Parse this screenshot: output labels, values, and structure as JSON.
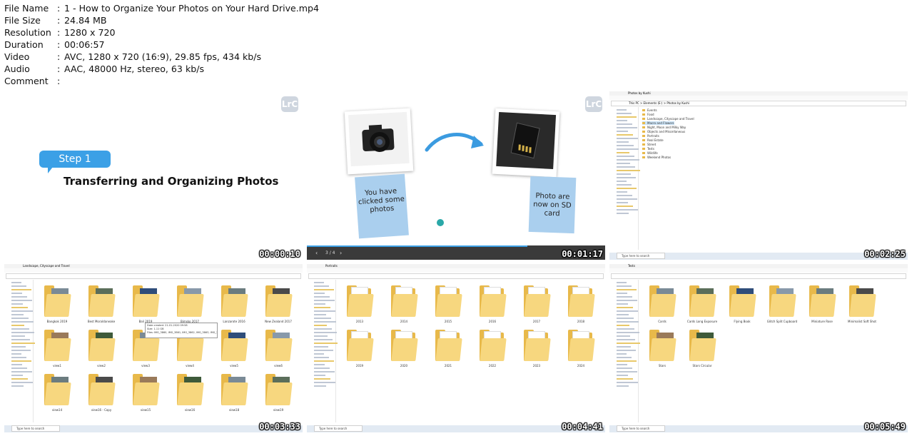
{
  "meta": {
    "rows": [
      {
        "k": "File Name",
        "v": "1 - How to Organize Your Photos on Your Hard Drive.mp4"
      },
      {
        "k": "File Size",
        "v": "24.84 MB"
      },
      {
        "k": "Resolution",
        "v": "1280 x 720"
      },
      {
        "k": "Duration",
        "v": "00:06:57"
      },
      {
        "k": "Video",
        "v": "AVC, 1280 x 720 (16:9), 29.85 fps, 434 kb/s"
      },
      {
        "k": "Audio",
        "v": "AAC, 48000 Hz, stereo, 63 kb/s"
      },
      {
        "k": "Comment",
        "v": ""
      }
    ],
    "sep": ":"
  },
  "thumbs": [
    {
      "timestamp": "00:00:10",
      "step_label": "Step 1",
      "heading": "Transferring and Organizing Photos",
      "badge": "LrC"
    },
    {
      "timestamp": "00:01:17",
      "note1": "You have clicked some photos",
      "note2": "Photo are now on SD card",
      "badge": "LrC",
      "pager": "3 / 4"
    },
    {
      "timestamp": "00:02:25",
      "window_title": "Photos by Kushi",
      "path": "This PC > Elements (E:) > Photos by Kushi",
      "folders": [
        "Events",
        "Food",
        "Landscape, Cityscape and Travel",
        "Macro and Flowers",
        "Night, Moon and Milky Way",
        "Objects and Miscellaneous",
        "Portraits",
        "Real Estate",
        "Street",
        "Tests",
        "Wildlife",
        "Weekend Photos"
      ],
      "search": "Type here to search"
    },
    {
      "timestamp": "00:03:33",
      "window_title": "Landscape, Cityscape and Travel",
      "labels": [
        "Bangkok 2019",
        "Best Moraldaneake",
        "Bali 2019",
        "Bimsko 2017",
        "Lanzarote 2016",
        "New Zealand 2017",
        "view1",
        "view2",
        "view3",
        "view4",
        "view5",
        "view6",
        "view14",
        "view16 - Copy",
        "view15",
        "view16",
        "view18",
        "view19"
      ],
      "tooltip": "Date created: 21-01-2020 09:58\nSize: 1.11 GB\nFiles: IMG_3860, IMG_3861, IMG_3862, IMG_3863, IMG_3864",
      "search": "Type here to search"
    },
    {
      "timestamp": "00:04:41",
      "window_title": "Portraits",
      "labels": [
        "2013",
        "2014",
        "2015",
        "2016",
        "2017",
        "2018",
        "2019",
        "2020",
        "2021",
        "2022",
        "2023",
        "2024"
      ],
      "search": "Type here to search"
    },
    {
      "timestamp": "00:05:49",
      "window_title": "Tests",
      "labels": [
        "Cards",
        "Cards Long Exposure",
        "Flying Book",
        "Glitch Split Cupboard",
        "Miniature Rose",
        "Minimalist Soft Shot",
        "Stars",
        "Stars Circular"
      ],
      "search": "Type here to search"
    }
  ]
}
